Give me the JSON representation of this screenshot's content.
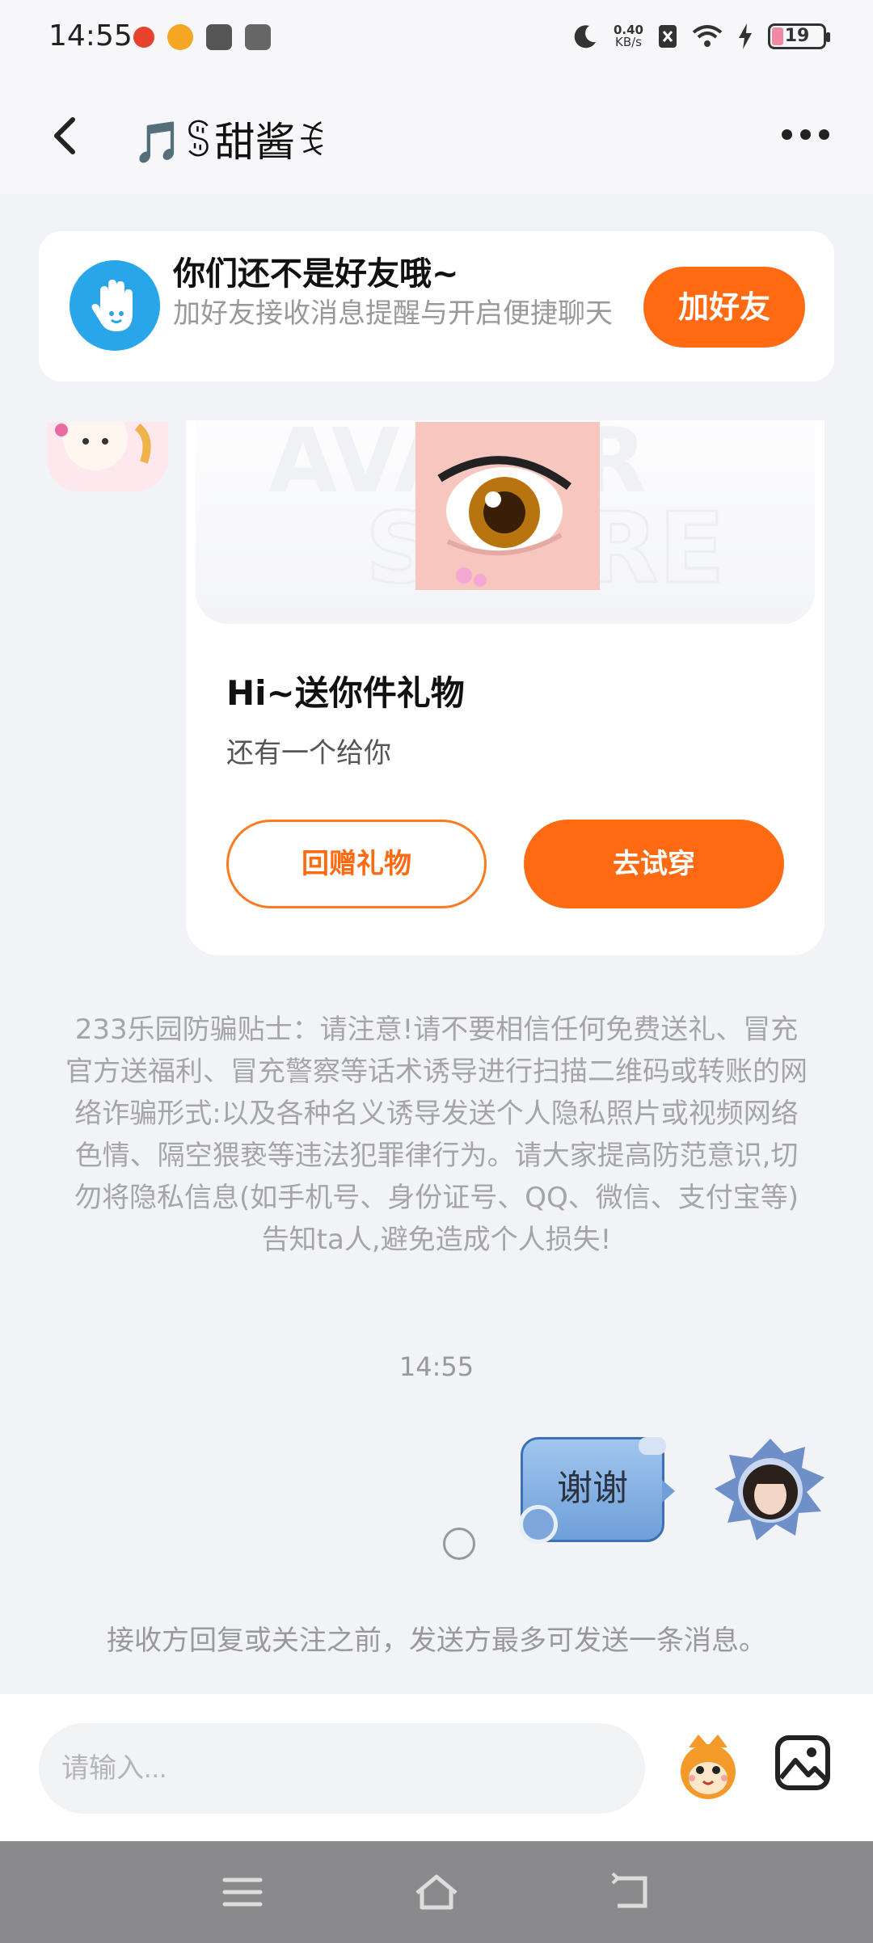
{
  "status_bar": {
    "time": "14:55",
    "net_speed_value": "0.40",
    "net_speed_unit": "KB/s",
    "battery": "19",
    "icons": [
      "weibo-red-icon",
      "weibo-icon",
      "mail-icon",
      "vivo-icon",
      "moon-icon",
      "no-sim-icon",
      "wifi-icon",
      "charging-icon"
    ]
  },
  "header": {
    "title": "🎵ꌚ甜酱ꉂ"
  },
  "friend_banner": {
    "title": "你们还不是好友哦~",
    "subtitle": "加好友接收消息提醒与开启便捷聊天",
    "button": "加好友",
    "accent": "#ff6a13",
    "icon_color": "#29a6ea"
  },
  "gift_card": {
    "title": "Hi~送你件礼物",
    "subtitle": "还有一个给你",
    "return_button": "回赠礼物",
    "try_button": "去试穿"
  },
  "notice": "233乐园防骗贴士：请注意!请不要相信任何免费送礼、冒充官方送福利、冒充警察等话术诱导进行扫描二维码或转账的网络诈骗形式:以及各种名义诱导发送个人隐私照片或视频网络色情、隔空猥亵等违法犯罪律行为。请大家提高防范意识,切勿将隐私信息(如手机号、身份证号、QQ、微信、支付宝等)告知ta人,避免造成个人损失!",
  "timestamp": "14:55",
  "sent_message": {
    "text": "谢谢"
  },
  "limit_note": "接收方回复或关注之前，发送方最多可发送一条消息。",
  "input": {
    "placeholder": "请输入..."
  }
}
